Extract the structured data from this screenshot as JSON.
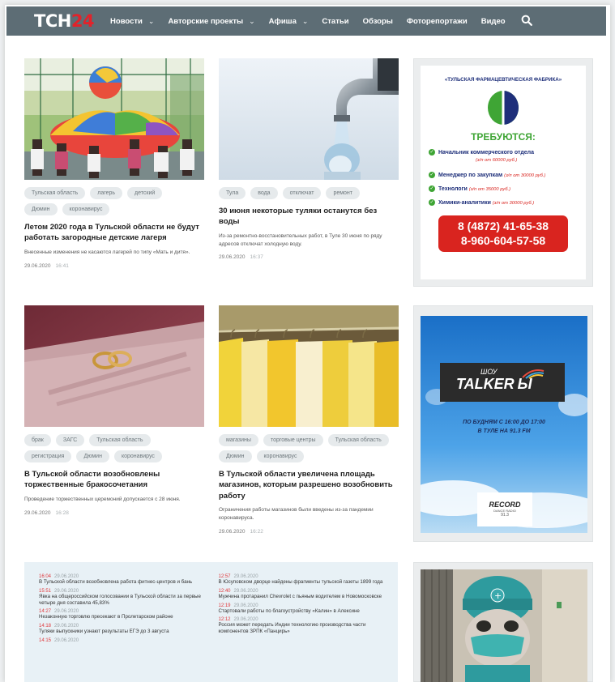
{
  "header": {
    "logo_main": "ТСН",
    "logo_accent": "24",
    "nav": [
      {
        "label": "Новости",
        "dropdown": true
      },
      {
        "label": "Авторские проекты",
        "dropdown": true
      },
      {
        "label": "Афиша",
        "dropdown": true
      },
      {
        "label": "Статьи",
        "dropdown": false
      },
      {
        "label": "Обзоры",
        "dropdown": false
      },
      {
        "label": "Фоторепортажи",
        "dropdown": false
      },
      {
        "label": "Видео",
        "dropdown": false
      }
    ],
    "chevron": "⌄",
    "search_icon": "search-icon"
  },
  "articles": [
    {
      "tags": [
        "Тульская область",
        "лагерь",
        "детский",
        "Дюмин",
        "коронавирус"
      ],
      "title": "Летом 2020 года в Тульской области не будут работать загородные детские лагеря",
      "lead": "Внесенные изменения не касаются лагерей по типу «Мать и дитя».",
      "date": "29.06.2020",
      "time": "16:41"
    },
    {
      "tags": [
        "Тула",
        "вода",
        "отключат",
        "ремонт"
      ],
      "title": "30 июня некоторые туляки останутся без воды",
      "lead": "Из-за ремонтно-восстановительных работ, в Туле 30 июня по ряду адресов отключат холодную воду.",
      "date": "29.06.2020",
      "time": "16:37"
    },
    {
      "tags": [
        "брак",
        "ЗАГС",
        "Тульская область",
        "регистрация",
        "Дюмин",
        "коронавирус"
      ],
      "title": "В Тульской области возобновлены торжественные бракосочетания",
      "lead": "Проведение торжественных церемоний допускается с 28 июня.",
      "date": "29.06.2020",
      "time": "16:28"
    },
    {
      "tags": [
        "магазины",
        "торговые центры",
        "Тульская область",
        "Дюмин",
        "коронавирус"
      ],
      "title": "В Тульской области увеличена площадь магазинов, которым разрешено возобновить работу",
      "lead": "Ограничения работы магазинов были введены из-за пандемии коронавируса.",
      "date": "29.06.2020",
      "time": "16:22"
    }
  ],
  "ad_pharma": {
    "company": "«ТУЛЬСКАЯ ФАРМАЦЕВТИЧЕСКАЯ ФАБРИКА»",
    "heading": "ТРЕБУЮТСЯ:",
    "items": [
      {
        "role": "Начальник коммерческого отдела",
        "salary": "(з/п от 60000 руб.)"
      },
      {
        "role": "Менеджер по закупкам",
        "salary": "(з/п от 30000 руб.)"
      },
      {
        "role": "Технологи",
        "salary": "(з/п от 35000 руб.)"
      },
      {
        "role": "Химики-аналитики",
        "salary": "(з/п от 30000 руб.)"
      }
    ],
    "phone1": "8 (4872) 41-65-38",
    "phone2": "8-960-604-57-58",
    "colors": {
      "green": "#3fa535",
      "navy": "#1e2f7a",
      "red": "#d9241f"
    }
  },
  "ad_talker": {
    "show": "ШОУ",
    "brand_a": "TALKER",
    "brand_b": "Ы",
    "schedule_1": "ПО БУДНЯМ С 16:00 ДО 17:00",
    "schedule_2": "В ТУЛЕ НА 91.3 FM",
    "radio": "RECORD",
    "radio_sub": "DANCE RADIO",
    "freq": "91.3"
  },
  "feed": {
    "left": [
      {
        "time": "16:04",
        "date": "29.06.2020",
        "text": "В Тульской области возобновлена работа фитнес-центров и бань"
      },
      {
        "time": "15:51",
        "date": "29.06.2020",
        "text": "Явка на общероссийском голосовании в Тульской области за первые четыре дня составила 45,83%"
      },
      {
        "time": "14:27",
        "date": "29.06.2020",
        "text": "Незаконную торговлю пресекают в Пролетарском районе"
      },
      {
        "time": "14:18",
        "date": "29.06.2020",
        "text": "Туляки выпускники узнают результаты ЕГЭ до 3 августа"
      },
      {
        "time": "14:15",
        "date": "29.06.2020",
        "text": ""
      }
    ],
    "right": [
      {
        "time": "12:57",
        "date": "29.06.2020",
        "text": "В Юсуповском дворце найдены фрагменты тульской газеты 1899 года"
      },
      {
        "time": "12:40",
        "date": "29.06.2020",
        "text": "Мужчина протаранил Chevrolet с пьяным водителем в Новомосковске"
      },
      {
        "time": "12:19",
        "date": "29.06.2020",
        "text": "Стартовали работы по благоустройству «Калин» в Алексине"
      },
      {
        "time": "12:12",
        "date": "29.06.2020",
        "text": "Россия может передать Индии технологию производства части компонентов ЗРПК «Панцирь»"
      }
    ]
  }
}
